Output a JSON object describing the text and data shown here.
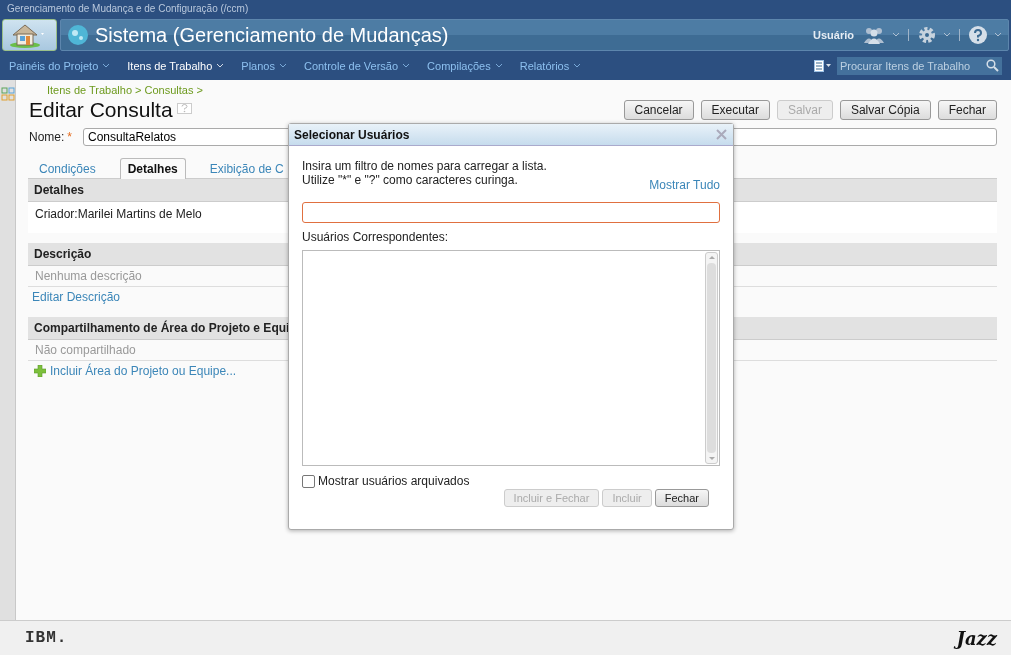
{
  "app_title": "Gerenciamento de Mudança e de Configuração (/ccm)",
  "banner": {
    "title": "Sistema (Gerenciamento de Mudanças)",
    "user_label": "Usuário"
  },
  "nav": [
    {
      "label": "Painéis do Projeto",
      "selected": false
    },
    {
      "label": "Itens de Trabalho",
      "selected": true
    },
    {
      "label": "Planos",
      "selected": false
    },
    {
      "label": "Controle de Versão",
      "selected": false
    },
    {
      "label": "Compilações",
      "selected": false
    },
    {
      "label": "Relatórios",
      "selected": false
    }
  ],
  "search": {
    "placeholder": "Procurar Itens de Trabalho"
  },
  "breadcrumb": "Itens de Trabalho > Consultas >",
  "page_title": "Editar Consulta",
  "actions": [
    {
      "label": "Cancelar",
      "disabled": false
    },
    {
      "label": "Executar",
      "disabled": false
    },
    {
      "label": "Salvar",
      "disabled": true
    },
    {
      "label": "Salvar Cópia",
      "disabled": false
    },
    {
      "label": "Fechar",
      "disabled": false
    }
  ],
  "name_field": {
    "label": "Nome:",
    "required_mark": "*",
    "value": "ConsultaRelatos"
  },
  "tabs": [
    {
      "label": "Condições",
      "selected": false
    },
    {
      "label": "Detalhes",
      "selected": true
    },
    {
      "label": "Exibição de C",
      "selected": false
    }
  ],
  "sections": [
    {
      "title": "Detalhes",
      "lines": [
        {
          "kind": "text",
          "text": "Criador:Marilei Martins de Melo"
        }
      ]
    },
    {
      "title": "Descrição",
      "lines": [
        {
          "kind": "muted",
          "text": "Nenhuma descrição"
        },
        {
          "kind": "link",
          "text": "Editar Descrição"
        }
      ]
    },
    {
      "title": "Compartilhamento de Área do Projeto e Equi",
      "lines": [
        {
          "kind": "muted",
          "text": "Não compartilhado"
        },
        {
          "kind": "add_link",
          "text": "Incluir Área do Projeto ou Equipe..."
        }
      ]
    }
  ],
  "dialog": {
    "title": "Selecionar Usuários",
    "instructions": [
      "Insira um filtro de nomes para carregar a lista.",
      "Utilize \"*\" e \"?\" como caracteres curinga."
    ],
    "show_all_link": "Mostrar Tudo",
    "list_label": "Usuários Correspondentes:",
    "archived": {
      "label": "Mostrar usuários arquivados",
      "checked": false
    },
    "buttons": [
      {
        "label": "Incluir e Fechar",
        "disabled": true
      },
      {
        "label": "Incluir",
        "disabled": true
      },
      {
        "label": "Fechar",
        "disabled": false
      }
    ]
  },
  "footer": {
    "left_logo": "IBM.",
    "right_logo": "Jazz"
  }
}
